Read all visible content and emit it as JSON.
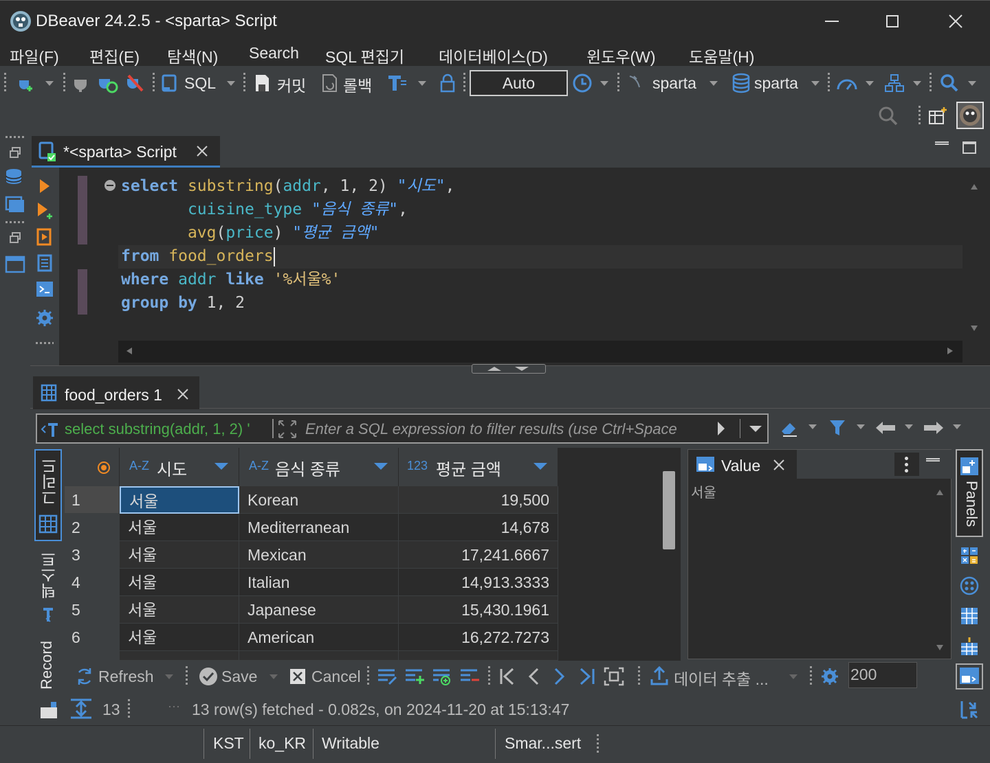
{
  "window": {
    "title": "DBeaver 24.2.5 - <sparta> Script"
  },
  "menu": [
    "파일(F)",
    "편집(E)",
    "탐색(N)",
    "Search",
    "SQL 편집기",
    "데이터베이스(D)",
    "윈도우(W)",
    "도움말(H)"
  ],
  "toolbar": {
    "sql_label": "SQL",
    "commit_label": "커밋",
    "rollback_label": "롤백",
    "transaction_mode": "Auto",
    "datasource": "sparta",
    "schema": "sparta"
  },
  "editor": {
    "tab_title": "*<sparta> Script",
    "lines": {
      "l1": {
        "kw1": "select",
        "fn1": "substring",
        "p1": "(",
        "id1": "addr",
        "rest1": ", 1, 2) ",
        "alias1": "\"시도\"",
        "end1": ","
      },
      "l2": {
        "id": "cuisine_type",
        "alias": "\"음식 종류\"",
        "end": ","
      },
      "l3": {
        "fn": "avg",
        "p1": "(",
        "id": "price",
        "p2": ") ",
        "alias": "\"평균 금액\""
      },
      "l4": {
        "kw": "from",
        "id": "food_orders"
      },
      "l5": {
        "kw1": "where",
        "id": "addr",
        "kw2": "like",
        "str": "'%서울%'"
      },
      "l6": {
        "kw": "group by",
        "rest": " 1, 2"
      }
    }
  },
  "results": {
    "tab_title": "food_orders 1",
    "query_preview": "select substring(addr, 1, 2) '",
    "filter_placeholder": "Enter a SQL expression to filter results (use Ctrl+Space",
    "side_tabs": {
      "grid": "그리드",
      "text": "텍스트",
      "record": "Record"
    },
    "columns": [
      {
        "type": "A-Z",
        "name": "시도"
      },
      {
        "type": "A-Z",
        "name": "음식 종류"
      },
      {
        "type": "123",
        "name": "평균 금액"
      }
    ],
    "rows": [
      {
        "n": "1",
        "sido": "서울",
        "cuisine": "Korean",
        "avg": "19,500"
      },
      {
        "n": "2",
        "sido": "서울",
        "cuisine": "Mediterranean",
        "avg": "14,678"
      },
      {
        "n": "3",
        "sido": "서울",
        "cuisine": "Mexican",
        "avg": "17,241.6667"
      },
      {
        "n": "4",
        "sido": "서울",
        "cuisine": "Italian",
        "avg": "14,913.3333"
      },
      {
        "n": "5",
        "sido": "서울",
        "cuisine": "Japanese",
        "avg": "15,430.1961"
      },
      {
        "n": "6",
        "sido": "서울",
        "cuisine": "American",
        "avg": "16,272.7273"
      }
    ],
    "value_panel": {
      "title": "Value",
      "content": "서울"
    },
    "panels_label": "Panels",
    "bottom_toolbar": {
      "refresh": "Refresh",
      "save": "Save",
      "cancel": "Cancel",
      "export": "데이터 추출 ...",
      "fetch_size": "200"
    },
    "row_count": "13",
    "status": "13 row(s) fetched - 0.082s, on 2024-11-20 at 15:13:47"
  },
  "statusbar": {
    "timezone": "KST",
    "locale": "ko_KR",
    "mode": "Writable",
    "insert": "Smar...sert"
  },
  "colors": {
    "accent": "#3d7dbf",
    "selected_cell": "#1d4f7c",
    "keyword": "#75a8e0",
    "function": "#d7b55a",
    "identifier": "#4ab8c8"
  }
}
